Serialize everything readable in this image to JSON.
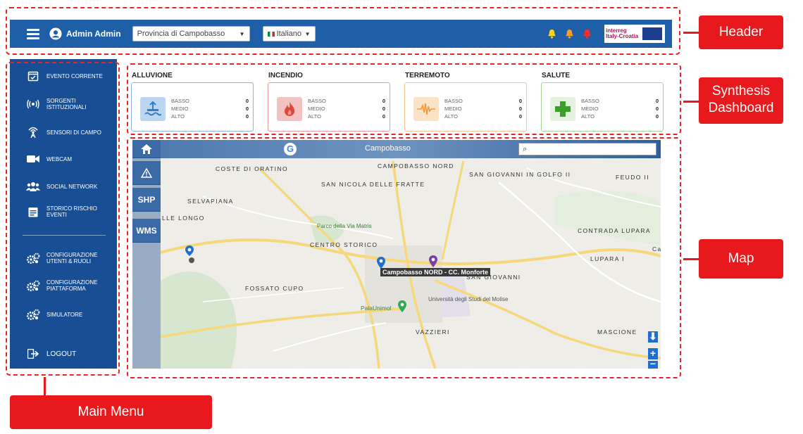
{
  "header": {
    "user_name": "Admin Admin",
    "province": "Provincia di Campobasso",
    "language": "Italiano",
    "logo_text": "interreg Italy-Croatia",
    "bell_colors": [
      "#ffd21f",
      "#ff9d1f",
      "#ff2a2a"
    ]
  },
  "sidebar": {
    "items": [
      {
        "label": "EVENTO CORRENTE",
        "icon": "calendar-check-icon"
      },
      {
        "label": "SORGENTI\nISTITUZIONALI",
        "icon": "broadcast-icon"
      },
      {
        "label": "SENSORI DI CAMPO",
        "icon": "antenna-icon"
      },
      {
        "label": "WEBCAM",
        "icon": "video-camera-icon"
      },
      {
        "label": "SOCIAL NETWORK",
        "icon": "users-icon"
      },
      {
        "label": "STORICO RISCHIO\nEVENTI",
        "icon": "calendar-icon"
      },
      {
        "label": "CONFIGURAZIONE\nUTENTI & RUOLI",
        "icon": "gears-icon"
      },
      {
        "label": "CONFIGURAZIONE\nPIATTAFORMA",
        "icon": "gears-icon"
      },
      {
        "label": "SIMULATORE",
        "icon": "gears-icon"
      },
      {
        "label": "LOGOUT",
        "icon": "logout-icon"
      }
    ]
  },
  "dashboard": {
    "cards": [
      {
        "title": "ALLUVIONE",
        "icon": "flood-icon",
        "color": "#5b9bd5",
        "rows": [
          {
            "label": "BASSO",
            "value": "0"
          },
          {
            "label": "MEDIO",
            "value": "0"
          },
          {
            "label": "ALTO",
            "value": "0"
          }
        ]
      },
      {
        "title": "INCENDIO",
        "icon": "fire-icon",
        "color": "#e06666",
        "rows": [
          {
            "label": "BASSO",
            "value": "0"
          },
          {
            "label": "MEDIO",
            "value": "0"
          },
          {
            "label": "ALTO",
            "value": "0"
          }
        ]
      },
      {
        "title": "TERREMOTO",
        "icon": "seismograph-icon",
        "color": "#f6b26b",
        "rows": [
          {
            "label": "BASSO",
            "value": "0"
          },
          {
            "label": "MEDIO",
            "value": "0"
          },
          {
            "label": "ALTO",
            "value": "0"
          }
        ]
      },
      {
        "title": "SALUTE",
        "icon": "health-cross-icon",
        "color": "#6aa84f",
        "rows": [
          {
            "label": "BASSO",
            "value": "0"
          },
          {
            "label": "MEDIO",
            "value": "0"
          },
          {
            "label": "ALTO",
            "value": "0"
          }
        ]
      }
    ]
  },
  "map": {
    "title": "Campobasso",
    "search_value": "",
    "tools": [
      "home-icon",
      "warning-icon",
      "SHP",
      "WMS"
    ],
    "popup_label": "Campobasso NORD - CC. Monforte",
    "places": [
      {
        "name": "COSTE DI\nORATINO"
      },
      {
        "name": "CAMPOBASSO\nNORD"
      },
      {
        "name": "SAN GIOVANNI\nIN GOLFO II"
      },
      {
        "name": "FEUDO II"
      },
      {
        "name": "SAN NICOLA\nDELLE FRATTE"
      },
      {
        "name": "SELVAPIANA"
      },
      {
        "name": "LLE LONGO"
      },
      {
        "name": "Parco della\nVia Matris"
      },
      {
        "name": "CENTRO STORICO"
      },
      {
        "name": "CONTRADA\nLUPARA"
      },
      {
        "name": "LUPARA I"
      },
      {
        "name": "SAN GIOVANNI"
      },
      {
        "name": "FOSSATO CUPO"
      },
      {
        "name": "PalaUnimol"
      },
      {
        "name": "Università\ndegli Studi\ndel Molise"
      },
      {
        "name": "VAZZIERI"
      },
      {
        "name": "MASCIONE"
      },
      {
        "name": "Ca"
      }
    ]
  },
  "annotations": {
    "header": "Header",
    "dashboard": "Synthesis\nDashboard",
    "map": "Map",
    "menu": "Main Menu"
  }
}
